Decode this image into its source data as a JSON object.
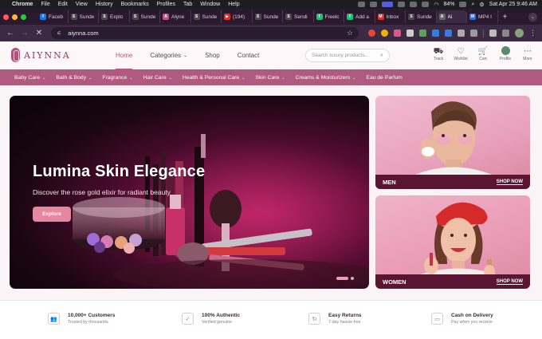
{
  "menubar": {
    "app": "Chrome",
    "items": [
      "File",
      "Edit",
      "View",
      "History",
      "Bookmarks",
      "Profiles",
      "Tab",
      "Window",
      "Help"
    ],
    "battery": "84%",
    "datetime": "Sat Apr 25  9:46 AM"
  },
  "tabs": [
    {
      "label": "Faceb",
      "color": "#1877f2",
      "glyph": "f"
    },
    {
      "label": "Sunde",
      "color": "#4a4a4a",
      "glyph": "S"
    },
    {
      "label": "Explo",
      "color": "#4a4a4a",
      "glyph": "S"
    },
    {
      "label": "Sunde",
      "color": "#4a4a4a",
      "glyph": "S"
    },
    {
      "label": "Alyne",
      "color": "#c0547f",
      "glyph": "A"
    },
    {
      "label": "Sunde",
      "color": "#4a4a4a",
      "glyph": "S"
    },
    {
      "label": "(194)",
      "color": "#e52d27",
      "glyph": "▶"
    },
    {
      "label": "Sunde",
      "color": "#4a4a4a",
      "glyph": "S"
    },
    {
      "label": "Sendi",
      "color": "#4a4a4a",
      "glyph": "S"
    },
    {
      "label": "Freelc",
      "color": "#1dbf73",
      "glyph": "f"
    },
    {
      "label": "Add a",
      "color": "#1dbf73",
      "glyph": "f"
    },
    {
      "label": "Inbox",
      "color": "#d93025",
      "glyph": "M"
    },
    {
      "label": "Sunde",
      "color": "#4a4a4a",
      "glyph": "S"
    },
    {
      "label": "Ai",
      "color": "#666666",
      "glyph": "A",
      "active": true
    },
    {
      "label": "MP4 I",
      "color": "#2f6fd8",
      "glyph": "M"
    }
  ],
  "toolbar": {
    "url": "aiynna.com"
  },
  "site": {
    "logo_text": "AIYNNA",
    "nav": [
      {
        "label": "Home",
        "active": true
      },
      {
        "label": "Categories",
        "dropdown": true
      },
      {
        "label": "Shop"
      },
      {
        "label": "Contact"
      }
    ],
    "search_placeholder": "Search luxury products...",
    "header_icons": [
      {
        "name": "track",
        "label": "Track",
        "glyph": "⛟"
      },
      {
        "name": "wishlist",
        "label": "Wishlist",
        "glyph": "♡"
      },
      {
        "name": "cart",
        "label": "Cart",
        "glyph": "🛒"
      },
      {
        "name": "profile",
        "label": "Profile",
        "glyph": ""
      },
      {
        "name": "more",
        "label": "More",
        "glyph": "⋯"
      }
    ]
  },
  "categories": [
    {
      "label": "Baby Care",
      "dropdown": true
    },
    {
      "label": "Bath & Body",
      "dropdown": true
    },
    {
      "label": "Fragrance",
      "dropdown": true
    },
    {
      "label": "Hair Care",
      "dropdown": true
    },
    {
      "label": "Health & Personal Care",
      "dropdown": true
    },
    {
      "label": "Skin Care",
      "dropdown": true
    },
    {
      "label": "Creams & Moisturizers",
      "dropdown": true
    },
    {
      "label": "Eau de Parfum",
      "dropdown": false
    }
  ],
  "hero": {
    "title": "Lumina Skin Elegance",
    "subtitle": "Discover the rose gold elixir for radiant beauty",
    "button": "Explore"
  },
  "promos": [
    {
      "name": "men",
      "label": "MEN",
      "cta": "SHOP NOW"
    },
    {
      "name": "women",
      "label": "WOMEN",
      "cta": "SHOP NOW"
    }
  ],
  "features": [
    {
      "title": "10,000+ Customers",
      "subtitle": "Trusted by thousands",
      "glyph": "👥"
    },
    {
      "title": "100% Authentic",
      "subtitle": "Verified genuine",
      "glyph": "✓"
    },
    {
      "title": "Easy Returns",
      "subtitle": "7-day hassle free",
      "glyph": "↻"
    },
    {
      "title": "Cash on Delivery",
      "subtitle": "Pay when you receive",
      "glyph": "▭"
    }
  ]
}
